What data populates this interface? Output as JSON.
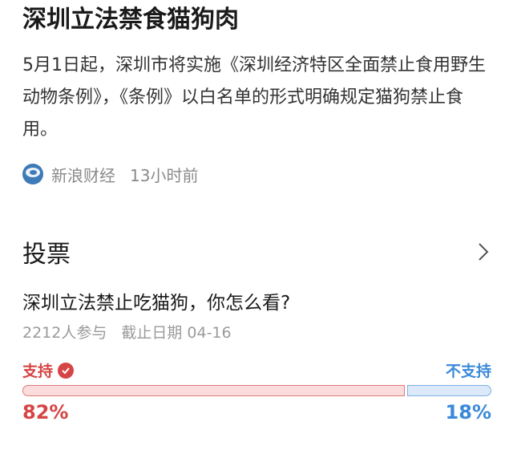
{
  "article": {
    "headline": "深圳立法禁食猫狗肉",
    "summary": "5月1日起，深圳市将实施《深圳经济特区全面禁止食用野生动物条例》，《条例》以白名单的形式明确规定猫狗禁止食用。",
    "source_name": "新浪财经",
    "source_time": "13小时前",
    "source_icon": "sina-logo-icon"
  },
  "poll": {
    "section_title": "投票",
    "question": "深圳立法禁止吃猫狗，你怎么看?",
    "participants": "2212人参与",
    "deadline": "截止日期 04-16",
    "options": [
      {
        "label": "支持",
        "percent_text": "82%",
        "share": 0.82,
        "color": "#d64545",
        "selected": true
      },
      {
        "label": "不支持",
        "percent_text": "18%",
        "share": 0.18,
        "color": "#3b8ad9",
        "selected": false
      }
    ]
  }
}
